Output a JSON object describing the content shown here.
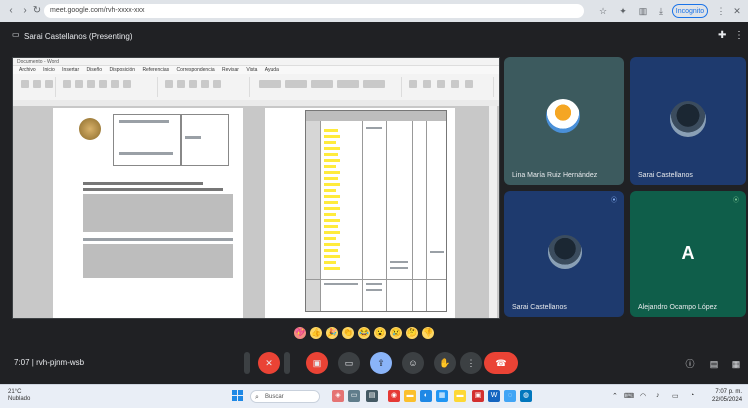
{
  "browser": {
    "address": "meet.google.com/rvh-xxxx-xxx",
    "profile_label": "Incognito",
    "icons": [
      "back-icon",
      "forward-icon",
      "reload-icon",
      "star-icon",
      "extensions-icon",
      "sidebar-icon",
      "menu-icon"
    ]
  },
  "meet": {
    "presenter_label": "Sarai Castellanos (Presenting)",
    "share": {
      "word_title": "Documento - Word",
      "ribbon_tabs": [
        "Archivo",
        "Inicio",
        "Insertar",
        "Diseño",
        "Disposición",
        "Referencias",
        "Correspondencia",
        "Revisar",
        "Vista",
        "Ayuda"
      ]
    },
    "participants": [
      {
        "name": "Lina María Ruiz Hernández",
        "bg": "#3c5a5e",
        "avatar": "photo"
      },
      {
        "name": "Sarai Castellanos",
        "bg": "#1e3a6e",
        "avatar": "photo"
      },
      {
        "name": "Sarai Castellanos",
        "bg": "#1e3a6e",
        "avatar": "photo"
      },
      {
        "name": "Alejandro Ocampo López",
        "bg": "#0f5e4a",
        "avatar": "letter",
        "letter": "A"
      }
    ],
    "reactions": [
      "💖",
      "👍",
      "🎉",
      "👏",
      "😂",
      "😮",
      "😢",
      "🤔",
      "👎"
    ],
    "meeting_code": "7:07  |  rvh-pjnm-wsb",
    "controls": [
      "mic-off",
      "camera-off",
      "captions",
      "emoji",
      "present",
      "raise-hand",
      "more"
    ],
    "colors": {
      "background": "#202124",
      "end_call": "#ea4335",
      "accent": "#8ab4f8"
    }
  },
  "taskbar": {
    "weather_temp": "21°C",
    "weather_desc": "Nublado",
    "search_placeholder": "Buscar",
    "time": "7:07 p. m.",
    "date": "22/05/2024"
  }
}
